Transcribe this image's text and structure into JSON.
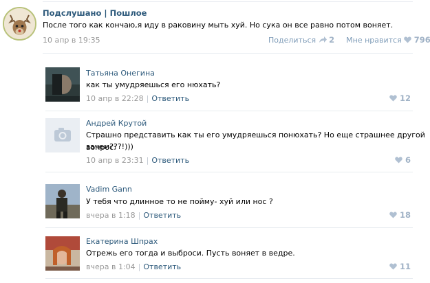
{
  "post": {
    "author": "Подслушано | Пошлое",
    "text": "После того как кончаю,я иду в раковину мыть хуй. Но сука он все равно потом воняет.",
    "date": "10 апр в 19:35",
    "share_label": "Поделиться",
    "share_count": "2",
    "like_label": "Мне нравится",
    "like_count": "796"
  },
  "comments": [
    {
      "name": "Татьяна Онегина",
      "text": "как ты умудряешься его нюхать?",
      "date": "10 апр в 22:28",
      "reply": "Ответить",
      "likes": "12"
    },
    {
      "name": "Андрей Крутой",
      "text": "Страшно представить как ты его умудряешься понюхать? Но еще страшнее другой вопрос:",
      "text2": "зачем???!)))",
      "date": "10 апр в 23:31",
      "reply": "Ответить",
      "likes": "6"
    },
    {
      "name": "Vadim Gann",
      "text": "У тебя что длинное то не пойму- хуй или нос ?",
      "date": "вчера в 1:18",
      "reply": "Ответить",
      "likes": "18"
    },
    {
      "name": "Екатерина Шпрах",
      "text": "Отрежь его тогда и выброси. Пусть воняет в ведре.",
      "date": "вчера в 1:04",
      "reply": "Ответить",
      "likes": "11"
    }
  ],
  "colors": {
    "link": "#2b587a",
    "meta": "#999999",
    "like": "#a0b2c6"
  },
  "icons": [
    "deer-avatar",
    "camera-placeholder-icon",
    "share-icon",
    "heart-icon"
  ]
}
